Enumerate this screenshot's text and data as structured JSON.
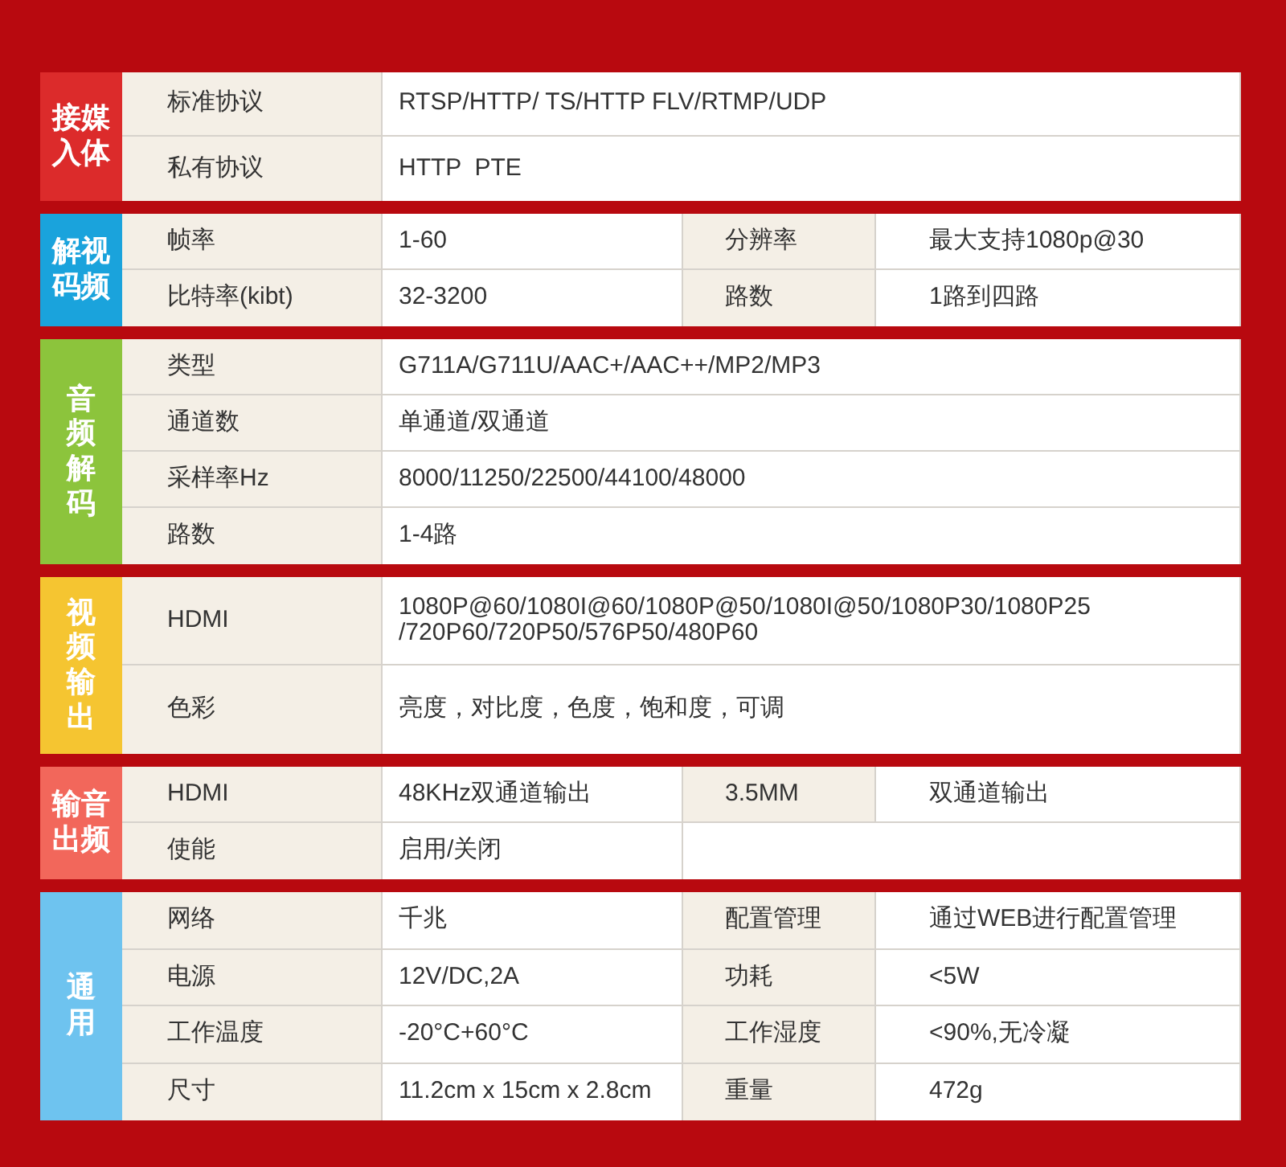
{
  "sections": [
    {
      "title": "接媒入体",
      "color": "#dc2b2b",
      "kind": "paired",
      "rows": [
        {
          "kind": "full",
          "cells": [
            "标准协议",
            "RTSP/HTTP/ TS/HTTP FLV/RTMP/UDP"
          ]
        },
        {
          "kind": "full",
          "cells": [
            "私有协议",
            "HTTP  PTE"
          ]
        }
      ]
    },
    {
      "title": "解视码频",
      "color": "#1aa3dc",
      "kind": "paired",
      "rows": [
        {
          "kind": "split",
          "cells": [
            "帧率",
            "1-60",
            "分辨率",
            "最大支持1080p@30"
          ]
        },
        {
          "kind": "split",
          "cells": [
            "比特率(kibt)",
            "32-3200",
            "路数",
            "1路到四路"
          ]
        }
      ]
    },
    {
      "title": "音频解码",
      "color": "#8cc43c",
      "kind": "stacked",
      "rows": [
        {
          "kind": "full",
          "cells": [
            "类型",
            "G711A/G711U/AAC+/AAC++/MP2/MP3"
          ]
        },
        {
          "kind": "full",
          "cells": [
            "通道数",
            "单通道/双通道"
          ]
        },
        {
          "kind": "full",
          "cells": [
            "采样率Hz",
            "8000/11250/22500/44100/48000"
          ]
        },
        {
          "kind": "full",
          "cells": [
            "路数",
            "1-4路"
          ]
        }
      ]
    },
    {
      "title": "视频输出",
      "color": "#f5c531",
      "kind": "stacked",
      "rows": [
        {
          "kind": "full",
          "cells": [
            "HDMI",
            "1080P@60/1080I@60/1080P@50/1080I@50/1080P30/1080P25 /720P60/720P50/576P50/480P60"
          ]
        },
        {
          "kind": "full",
          "cells": [
            "色彩",
            "亮度，对比度，色度，饱和度，可调"
          ]
        }
      ]
    },
    {
      "title": "输音出频",
      "color": "#f2675b",
      "kind": "paired",
      "rows": [
        {
          "kind": "split",
          "cells": [
            "HDMI",
            "48KHz双通道输出",
            "3.5MM",
            "双通道输出"
          ]
        },
        {
          "kind": "half",
          "cells": [
            "使能",
            "启用/关闭"
          ]
        }
      ]
    },
    {
      "title": "通用",
      "color": "#6ec3ef",
      "kind": "stacked",
      "rows": [
        {
          "kind": "split",
          "cells": [
            "网络",
            "千兆",
            "配置管理",
            "通过WEB进行配置管理"
          ]
        },
        {
          "kind": "split",
          "cells": [
            "电源",
            "12V/DC,2A",
            "功耗",
            "<5W"
          ]
        },
        {
          "kind": "split",
          "cells": [
            "工作温度",
            "-20°C+60°C",
            "工作湿度",
            "<90%,无冷凝"
          ]
        },
        {
          "kind": "split",
          "cells": [
            "尺寸",
            "11.2cm x 15cm x 2.8cm",
            "重量",
            "472g"
          ]
        }
      ]
    }
  ]
}
